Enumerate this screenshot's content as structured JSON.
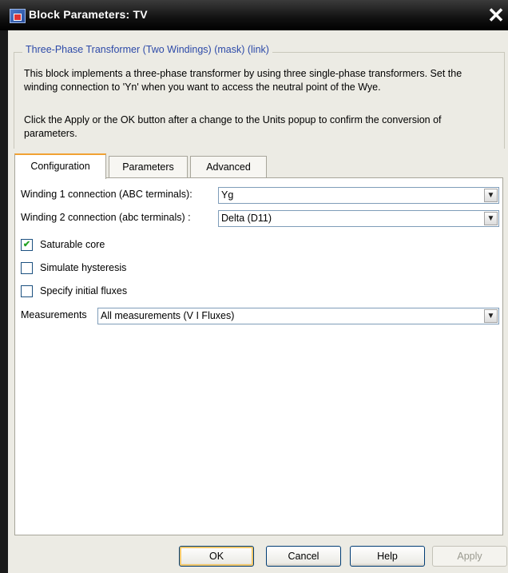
{
  "window": {
    "title": "Block Parameters: TV",
    "close_glyph": "✕"
  },
  "mask": {
    "group_title": "Three-Phase Transformer (Two Windings) (mask) (link)",
    "description": "This block implements a three-phase transformer by using three single-phase transformers. Set the winding connection to 'Yn'  when you want to access the neutral point of the Wye.",
    "instruction": "Click the Apply or the OK button after a change to the Units popup to confirm the conversion of parameters."
  },
  "tabs": [
    {
      "label": "Configuration",
      "active": true
    },
    {
      "label": "Parameters",
      "active": false
    },
    {
      "label": "Advanced",
      "active": false
    }
  ],
  "configuration": {
    "winding1": {
      "label": "Winding 1 connection (ABC terminals):",
      "value": "Yg"
    },
    "winding2": {
      "label": "Winding 2 connection (abc terminals) :",
      "value": "Delta (D11)"
    },
    "saturable_core": {
      "label": "Saturable core",
      "checked": true
    },
    "simulate_hysteresis": {
      "label": "Simulate hysteresis",
      "checked": false
    },
    "specify_initial_fluxes": {
      "label": "Specify initial fluxes",
      "checked": false
    },
    "measurements": {
      "label": "Measurements",
      "value": "All measurements (V I Fluxes)"
    }
  },
  "buttons": {
    "ok": "OK",
    "cancel": "Cancel",
    "help": "Help",
    "apply": "Apply"
  },
  "glyphs": {
    "check": "✔",
    "dropdown_arrow": "▼"
  },
  "colors": {
    "titlebar": "#111111",
    "group_title": "#2d4aa8",
    "active_tab_accent": "#f1a132"
  },
  "icons": {
    "app": "simulink-block-icon",
    "close": "close-icon",
    "dropdown": "chevron-down-icon",
    "check": "check-icon"
  }
}
